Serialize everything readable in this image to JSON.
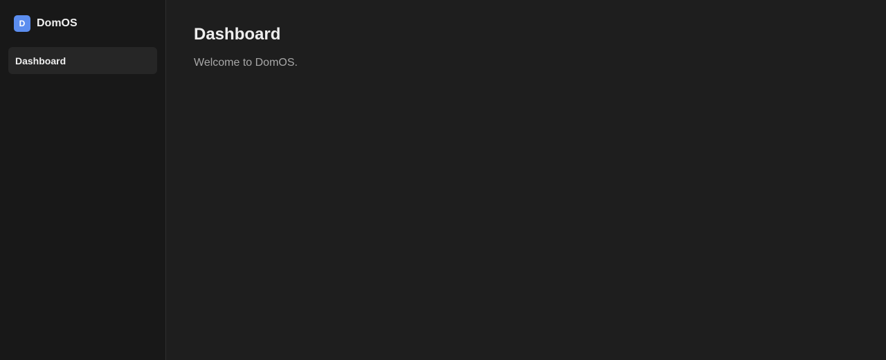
{
  "brand": {
    "logo_letter": "D",
    "name": "DomOS"
  },
  "sidebar": {
    "items": [
      {
        "label": "Dashboard",
        "active": true
      }
    ]
  },
  "main": {
    "title": "Dashboard",
    "welcome": "Welcome to DomOS."
  },
  "colors": {
    "accent": "#5b8def",
    "sidebar_bg": "#181818",
    "main_bg": "#1e1e1e",
    "active_item_bg": "#262626"
  }
}
